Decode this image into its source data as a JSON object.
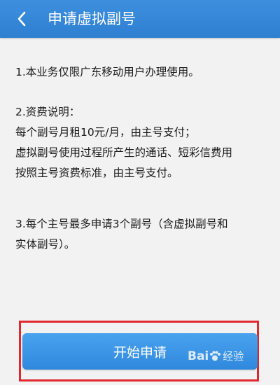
{
  "header": {
    "back_icon": "chevron-left-icon",
    "title": "申请虚拟副号"
  },
  "content": {
    "para1": [
      "1.本业务仅限广东移动用户办理使用。"
    ],
    "para2": [
      "2.资费说明：",
      "每个副号月租10元/月，由主号支付；",
      "虚拟副号使用过程所产生的通话、短彩信费用",
      "按照主号资费标准，由主号支付。"
    ],
    "para3": [
      "3.每个主号最多申请3个副号（含虚拟副号和",
      "实体副号）。"
    ]
  },
  "actions": {
    "start_label": "开始申请"
  },
  "watermark": {
    "brand": "Bai",
    "suffix": "经验"
  },
  "colors": {
    "header": "#2e7fd1",
    "button": "#3a94e4",
    "highlight": "#e0282e",
    "background": "#f2f2f2"
  }
}
